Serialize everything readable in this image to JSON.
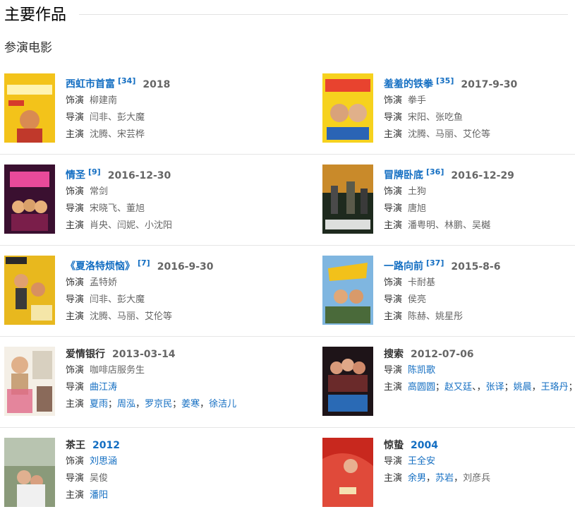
{
  "section": {
    "title": "主要作品",
    "subtitle": "参演电影"
  },
  "films": [
    {
      "title": "西虹市首富",
      "cite": "[34]",
      "year": "2018",
      "role_label": "饰演",
      "role": "柳建南",
      "dir_label": "导演",
      "director": "闫非、彭大魔",
      "cast_label": "主演",
      "cast": "沈腾、宋芸桦"
    },
    {
      "title": "羞羞的铁拳",
      "cite": "[35]",
      "year": "2017-9-30",
      "role_label": "饰演",
      "role": "拳手",
      "dir_label": "导演",
      "director": "宋阳、张吃鱼",
      "cast_label": "主演",
      "cast": "沈腾、马丽、艾伦等"
    },
    {
      "title": "情圣",
      "cite": "[9]",
      "year": "2016-12-30",
      "role_label": "饰演",
      "role": "常剑",
      "dir_label": "导演",
      "director": "宋晓飞、董旭",
      "cast_label": "主演",
      "cast": "肖央、闫妮、小沈阳"
    },
    {
      "title": "冒牌卧底",
      "cite": "[36]",
      "year": "2016-12-29",
      "role_label": "饰演",
      "role": "土狗",
      "dir_label": "导演",
      "director": "唐旭",
      "cast_label": "主演",
      "cast": "潘粤明、林鹏、吴樾"
    },
    {
      "title": "《夏洛特烦恼》",
      "cite": "[7]",
      "year": "2016-9-30",
      "role_label": "饰演",
      "role": "孟特娇",
      "dir_label": "导演",
      "director": "闫非、彭大魔",
      "cast_label": "主演",
      "cast": "沈腾、马丽、艾伦等"
    },
    {
      "title": "一路向前",
      "cite": "[37]",
      "year": "2015-8-6",
      "role_label": "饰演",
      "role": "卡耐基",
      "dir_label": "导演",
      "director": "侯亮",
      "cast_label": "主演",
      "cast": "陈赫、姚星彤"
    },
    {
      "title": "爱情银行",
      "year": "2013-03-14",
      "role_label": "饰演",
      "role": "咖啡店服务生",
      "dir_label": "导演",
      "director": "曲江涛",
      "cast_label": "主演",
      "cast_links": [
        "夏雨",
        "周泓",
        "罗京民",
        "姜寒",
        "徐洁儿"
      ],
      "cast_seps": [
        "；",
        "，",
        "；",
        "，"
      ]
    },
    {
      "title": "搜索",
      "year": "2012-07-06",
      "dir_label": "导演",
      "director": "陈凯歌",
      "cast_label": "主演",
      "cast_links": [
        "高圆圆",
        "赵又廷",
        "张译",
        "姚晨",
        "王珞丹"
      ],
      "cast_seps": [
        "；",
        "、，",
        "；",
        "，",
        "；"
      ]
    },
    {
      "title": "茶王",
      "year": "2012",
      "role_label": "饰演",
      "role": "刘思涵",
      "dir_label": "导演",
      "director": "吴俊",
      "cast_label": "主演",
      "cast": "潘阳"
    },
    {
      "title": "惊蛰",
      "year": "2004",
      "dir_label": "导演",
      "director": "王全安",
      "cast_label": "主演",
      "cast_links": [
        "余男",
        "苏岩"
      ],
      "cast_seps": [
        "，",
        "，"
      ],
      "cast_tail": "刘彦兵"
    }
  ],
  "colors": {
    "link": "#136ec2",
    "divider": "#e6e6e6"
  },
  "posters": [
    "poster-image",
    "poster-image",
    "poster-image",
    "poster-image",
    "poster-image",
    "poster-image",
    "poster-image",
    "poster-image",
    "poster-image",
    "poster-image"
  ]
}
